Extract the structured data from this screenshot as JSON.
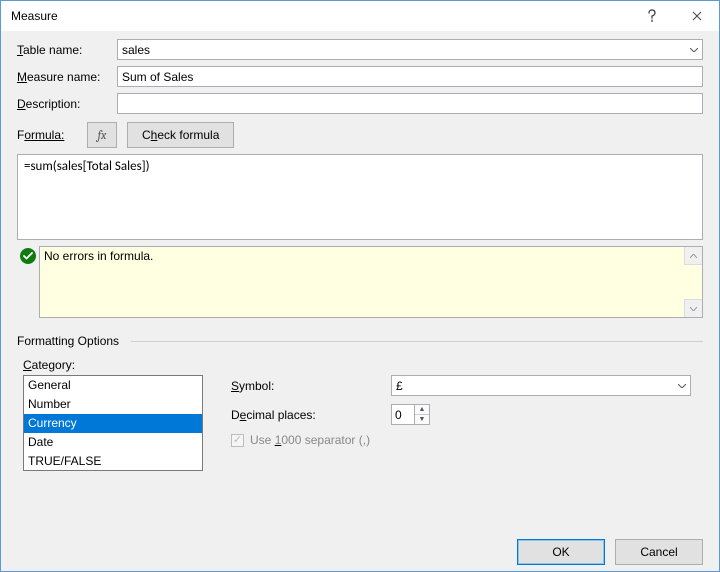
{
  "window": {
    "title": "Measure"
  },
  "labels": {
    "table_name": "Table name:",
    "measure_name": "Measure name:",
    "description": "Description:",
    "formula": "Formula:",
    "fx": "fx",
    "check_formula": "Check formula"
  },
  "fields": {
    "table_name": "sales",
    "measure_name": "Sum of Sales",
    "description": "",
    "formula_text": "=sum(sales[Total Sales])"
  },
  "status": {
    "message": "No errors in formula."
  },
  "formatting": {
    "section_title": "Formatting Options",
    "category_label": "Category:",
    "categories": [
      "General",
      "Number",
      "Currency",
      "Date",
      "TRUE/FALSE"
    ],
    "selected_index": 2,
    "symbol_label": "Symbol:",
    "symbol_value": "£",
    "decimal_label": "Decimal places:",
    "decimal_value": "0",
    "separator_label": "Use 1000 separator (,)",
    "separator_underline_char": "1",
    "separator_checked": true,
    "separator_enabled": false
  },
  "footer": {
    "ok": "OK",
    "cancel": "Cancel"
  },
  "underline": {
    "table_name_u": "T",
    "measure_name_u": "M",
    "description_u": "D",
    "formula_u": "ormula:",
    "check_u": "h",
    "category_u": "C",
    "symbol_u": "S",
    "decimal_u": "e"
  }
}
